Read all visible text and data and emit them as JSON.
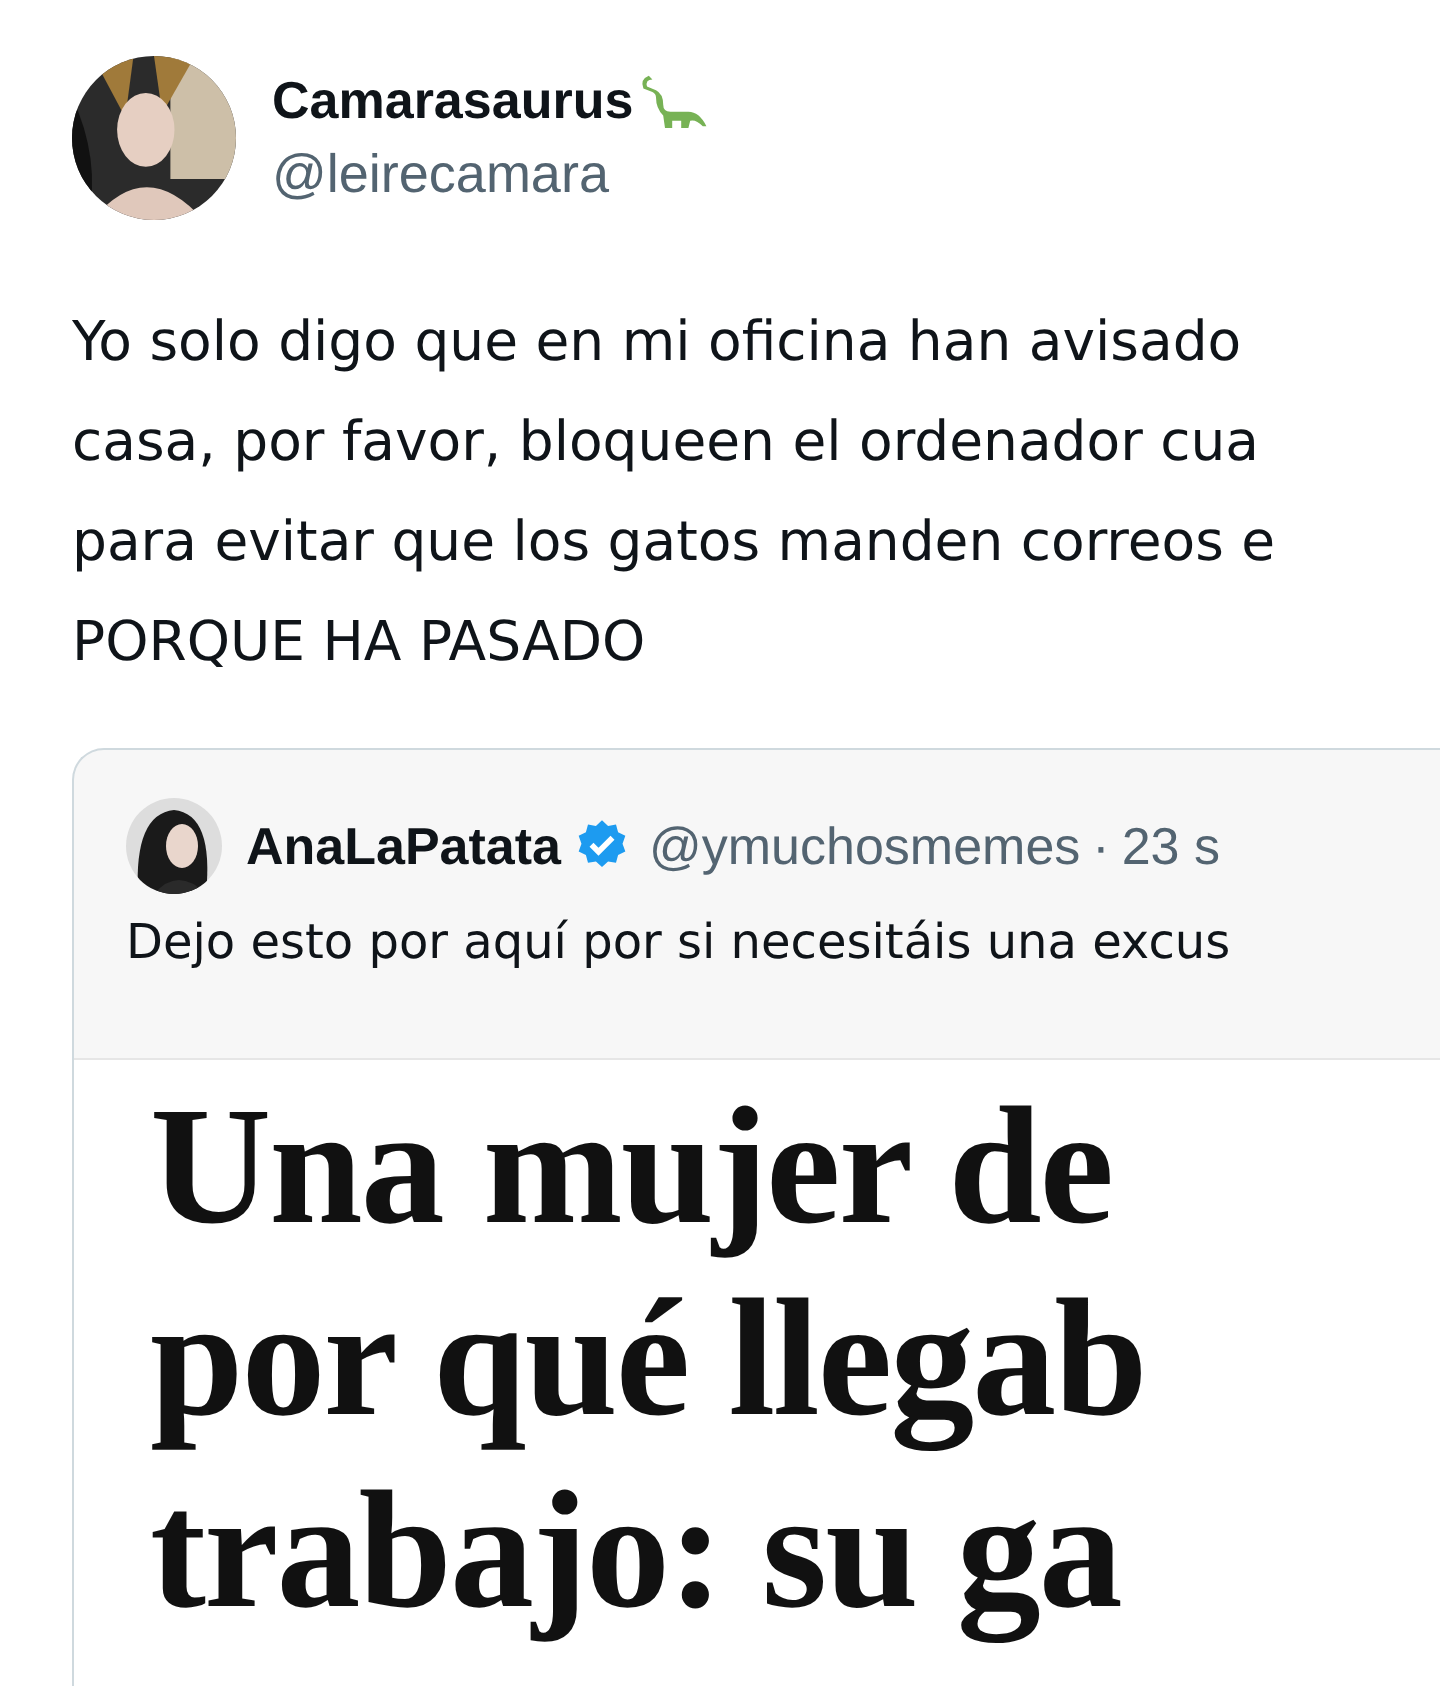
{
  "tweet": {
    "author": {
      "name": "Camarasaurus",
      "handle": "@leirecamara"
    },
    "text_lines": [
      "Yo solo digo que en mi oficina han avisado",
      "casa, por favor, bloqueen el ordenador cua",
      "para evitar que los gatos manden correos e",
      "PORQUE HA PASADO"
    ],
    "quote": {
      "author": {
        "name": "AnaLaPatata",
        "verified": true,
        "handle": "@ymuchosmemes",
        "separator": "·",
        "time": "23 s"
      },
      "text": "Dejo esto por aquí por si necesitáis una excus",
      "media": {
        "kind": "document",
        "headline_lines": [
          "Una mujer de",
          "por qué llegab",
          "trabajo: su ga"
        ]
      }
    }
  }
}
